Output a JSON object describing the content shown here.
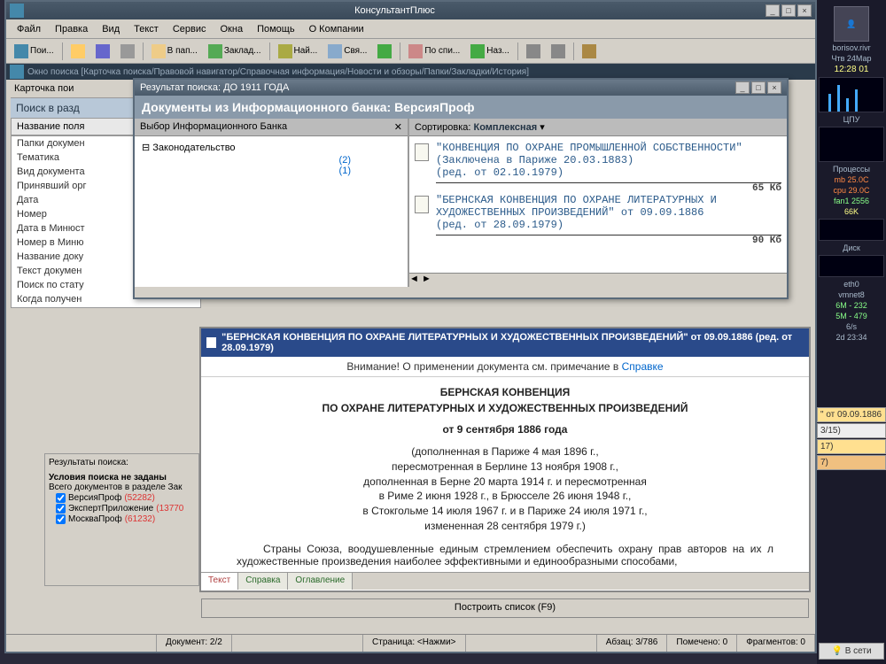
{
  "app": {
    "title": "КонсультантПлюс"
  },
  "menu": {
    "file": "Файл",
    "edit": "Правка",
    "view": "Вид",
    "text": "Текст",
    "service": "Сервис",
    "windows": "Окна",
    "help": "Помощь",
    "about": "О Компании"
  },
  "toolbar": {
    "search": "Пои...",
    "open": "В пап...",
    "bookmark": "Заклад...",
    "find": "Най...",
    "links": "Свя...",
    "list": "По спи...",
    "nav": "Наз..."
  },
  "mdi": {
    "title": "Окно поиска [Карточка поиска/Правовой навигатор/Справочная информация/Новости и обзоры/Папки/Закладки/История]"
  },
  "searchcard": {
    "tab": "Карточка пои",
    "heading": "Поиск в разд",
    "col": "Название поля",
    "fields": [
      "Папки докумен",
      "Тематика",
      "Вид документа",
      "Принявший орг",
      "Дата",
      "Номер",
      "Дата в Минюст",
      "Номер в Миню",
      "Название доку",
      "Текст докумен",
      "Поиск по стату",
      "Когда получен"
    ]
  },
  "results": {
    "header": "Результаты поиска:",
    "noterms": "Условия поиска не заданы",
    "total": "Всего документов в разделе Зак",
    "banks": [
      {
        "name": "ВерсияПроф",
        "count": "(52282)"
      },
      {
        "name": "ЭкспертПриложение",
        "count": "(13770"
      },
      {
        "name": "МоскваПроф",
        "count": "(61232)"
      }
    ]
  },
  "popup": {
    "title": "Результат поиска: ДО 1911 ГОДА",
    "subtitle": "Документы из Информационного банка: ВерсияПроф",
    "left_header": "Выбор Информационного Банка",
    "tree_root": "Законодательство",
    "tree_counts": [
      "(2)",
      "(1)"
    ],
    "sort_label": "Сортировка:",
    "sort_value": "Комплексная",
    "docs": [
      {
        "title": "\"КОНВЕНЦИЯ ПО ОХРАНЕ ПРОМЫШЛЕННОЙ СОБСТВЕННОСТИ\"",
        "sub1": "(Заключена в Париже 20.03.1883)",
        "sub2": "(ред. от 02.10.1979)",
        "size": "65 Кб"
      },
      {
        "title": "\"БЕРНСКАЯ КОНВЕНЦИЯ ПО ОХРАНЕ ЛИТЕРАТУРНЫХ И ХУДОЖЕСТВЕННЫХ ПРОИЗВЕДЕНИЙ\" от 09.09.1886",
        "sub1": "(ред. от 28.09.1979)",
        "sub2": "",
        "size": "90 Кб"
      }
    ]
  },
  "doc": {
    "title": "\"БЕРНСКАЯ КОНВЕНЦИЯ ПО ОХРАНЕ ЛИТЕРАТУРНЫХ И ХУДОЖЕСТВЕННЫХ ПРОИЗВЕДЕНИЙ\" от 09.09.1886 (ред. от 28.09.1979)",
    "warning_pre": "Внимание! О применении документа см. примечание в ",
    "warning_link": "Справке",
    "heading1": "БЕРНСКАЯ КОНВЕНЦИЯ",
    "heading2": "ПО ОХРАНЕ ЛИТЕРАТУРНЫХ И ХУДОЖЕСТВЕННЫХ ПРОИЗВЕДЕНИЙ",
    "date": "от 9 сентября 1886 года",
    "amend1": "(дополненная в Париже 4 мая 1896 г.,",
    "amend2": "пересмотренная в Берлине 13 ноября 1908 г.,",
    "amend3": "дополненная в Берне 20 марта 1914 г. и пересмотренная",
    "amend4": "в Риме 2 июня 1928 г., в Брюсселе 26 июня 1948 г.,",
    "amend5": "в Стокгольме 14 июля 1967 г. и в Париже 24 июля 1971 г.,",
    "amend6": "измененная 28 сентября 1979 г.)",
    "para": "Страны Союза, воодушевленные единым стремлением обеспечить охрану прав авторов на их л художественные произведения наиболее эффективными и единообразными способами,",
    "tabs": {
      "text": "Текст",
      "help": "Справка",
      "toc": "Оглавление"
    }
  },
  "build": {
    "label": "Построить список (F9)"
  },
  "status": {
    "doc": "Документ: 2/2",
    "page": "Страница: <Нажми>",
    "para": "Абзац: 3/786",
    "marked": "Помечено: 0",
    "frag": "Фрагментов: 0"
  },
  "rtabs": {
    "t1": "\" от 09.09.1886",
    "t2": "3/15)",
    "t3": "17)",
    "t4": "7)"
  },
  "sysmon": {
    "user": "borisov.rivr",
    "date": "Чтв 24Мар",
    "time": "12:28 01",
    "cpu": "ЦПУ",
    "proc": "Процессы",
    "mb": "mb 25.0C",
    "cpu_t": "cpu 29.0C",
    "fan": "fan1 2556",
    "hdd": "66K",
    "disk": "Диск",
    "eth": "eth0",
    "vmnet": "vmnet8",
    "net1": "6M - 232",
    "net2": "5M - 479",
    "net3": "6/s",
    "uptime": "2d 23:34",
    "net_status": "В сети"
  }
}
